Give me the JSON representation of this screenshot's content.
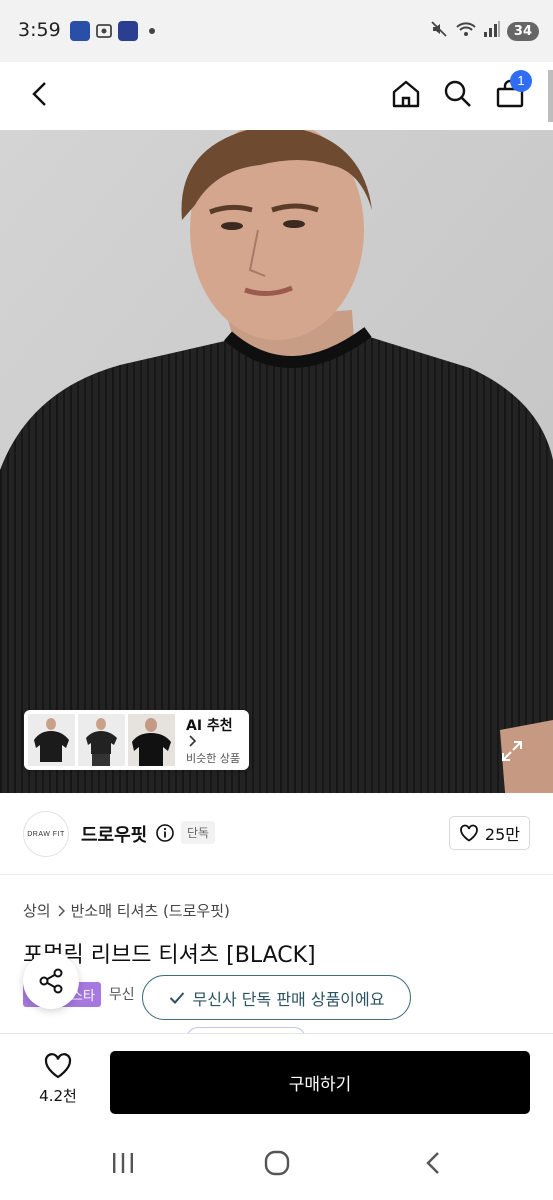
{
  "status_bar": {
    "time": "3:59",
    "battery": "34",
    "icons": [
      "keyboard-icon",
      "screenshot-icon",
      "app-icon",
      "mute-icon",
      "wifi-icon",
      "signal-icon",
      "battery-icon"
    ]
  },
  "nav": {
    "cart_count": "1",
    "icons": [
      "back-icon",
      "home-icon",
      "search-icon",
      "cart-icon"
    ]
  },
  "hero": {
    "ai_card": {
      "title": "AI 추천",
      "subtitle": "비슷한 상품"
    }
  },
  "brand": {
    "logo_text": "DRAW FIT",
    "name": "드로우핏",
    "exclusive_tag": "단독",
    "likes": "25만"
  },
  "product": {
    "breadcrumb": [
      "상의",
      "반소매 티셔츠 (드로우핏)"
    ],
    "title": "포멀릭 리브드 티셔츠 [BLACK]",
    "tag_purple": "스타",
    "tag_text": "무신"
  },
  "toast": {
    "text": "무신사 단독 판매 상품이에요"
  },
  "bottom_bar": {
    "wish_count": "4.2천",
    "buy_label": "구매하기"
  },
  "colors": {
    "accent_blue": "#2f6ef3",
    "toast_border": "#3f6f7a",
    "tag_purple": "#a678e0",
    "buy_button": "#000000"
  }
}
